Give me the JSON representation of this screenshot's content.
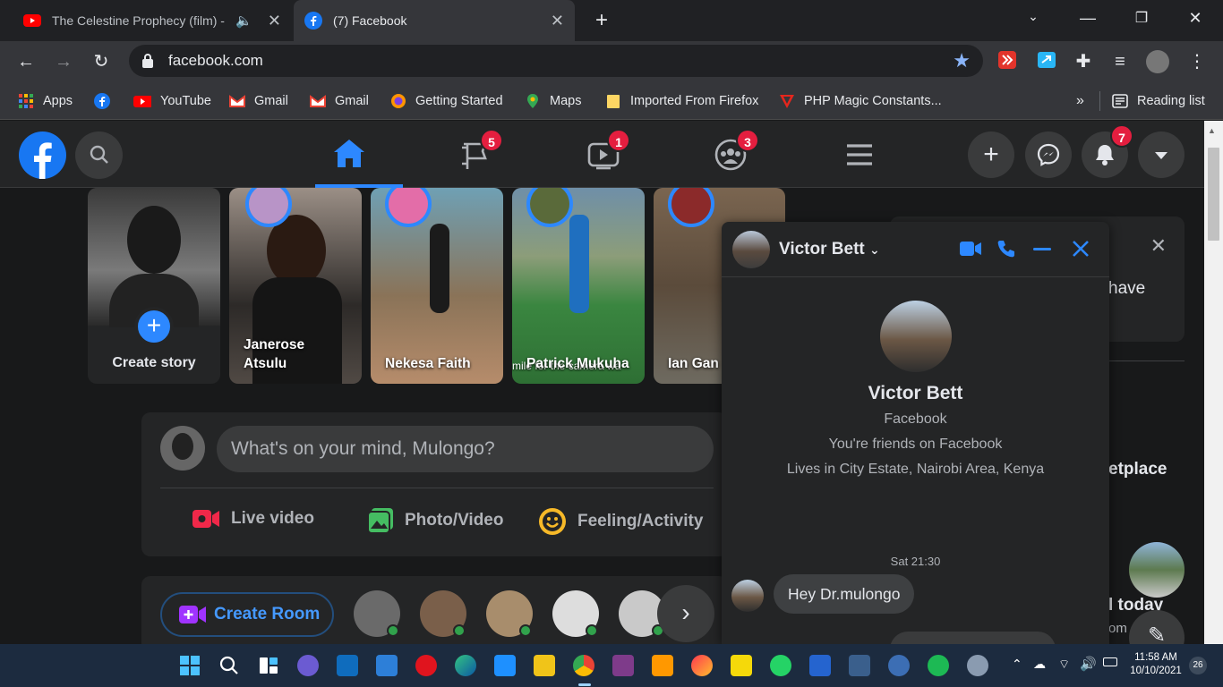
{
  "tabs": [
    {
      "title": "The Celestine Prophecy (film) -",
      "active": false
    },
    {
      "title": "(7) Facebook",
      "active": true
    }
  ],
  "toolbar": {
    "url": "facebook.com"
  },
  "bookmarks": [
    "Apps",
    "YouTube",
    "Gmail",
    "Gmail",
    "Getting Started",
    "Maps",
    "Imported From Firefox",
    "PHP Magic Constants...",
    "Reading list"
  ],
  "fb": {
    "badges": {
      "watch_feed": "5",
      "video": "1",
      "groups": "3",
      "notifications": "7"
    },
    "stories": [
      {
        "name": "Create story"
      },
      {
        "name": "Janerose Atsulu"
      },
      {
        "name": "Nekesa Faith"
      },
      {
        "name": "Patrick Mukuha"
      },
      {
        "name": "Ian Gan"
      }
    ],
    "story_overlay_text": "mile for the camera wa",
    "composer": {
      "placeholder": "What's on your mind, Mulongo?",
      "live": "Live video",
      "photo": "Photo/Video",
      "feeling": "Feeling/Activity"
    },
    "rooms": {
      "create": "Create Room"
    },
    "right_fragments": {
      "have": "have",
      "etplace": "etplace",
      "today": "l today",
      "om": "om"
    }
  },
  "chat": {
    "name": "Victor Bett",
    "profile_name": "Victor Bett",
    "subtitle": "Facebook",
    "friends": "You're friends on Facebook",
    "lives": "Lives in City Estate, Nairobi Area, Kenya",
    "timestamp": "Sat 21:30",
    "message": "Hey Dr.mulongo"
  },
  "taskbar": {
    "time": "11:58 AM",
    "date": "10/10/2021",
    "notif_count": "26"
  },
  "colors": {
    "fb_blue": "#1877f2",
    "accent_blue": "#2d88ff",
    "badge_red": "#e41e3f",
    "online_green": "#31a24c"
  }
}
